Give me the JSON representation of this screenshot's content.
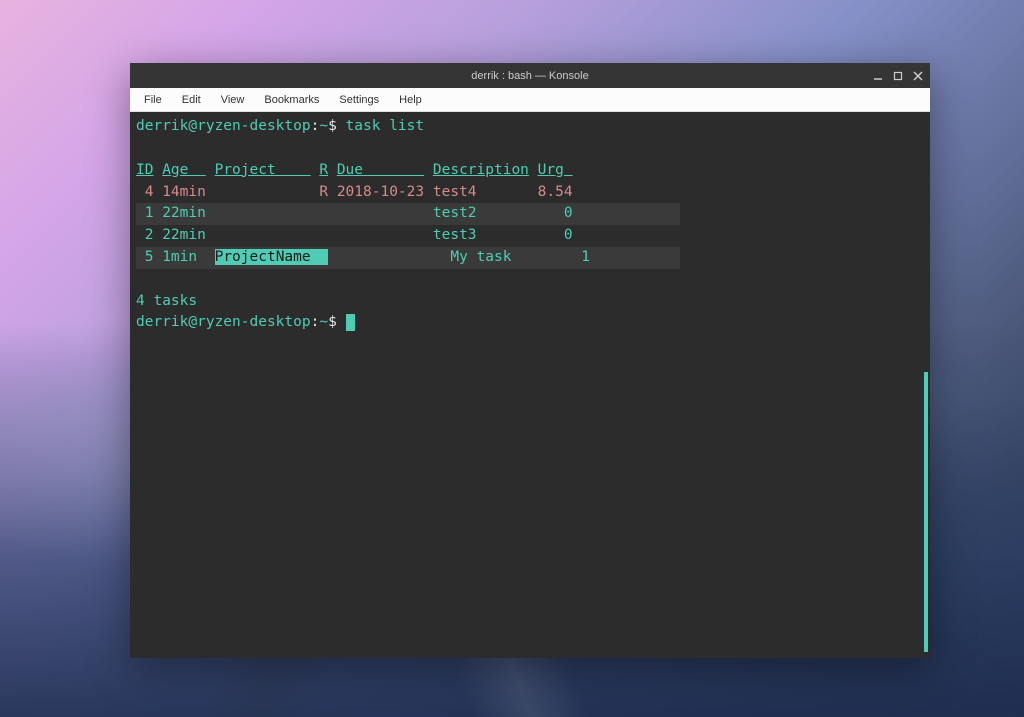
{
  "window": {
    "title": "derrik : bash — Konsole"
  },
  "menubar": {
    "items": [
      "File",
      "Edit",
      "View",
      "Bookmarks",
      "Settings",
      "Help"
    ]
  },
  "terminal": {
    "prompt_user": "derrik@ryzen-desktop",
    "prompt_sep": ":",
    "prompt_path": "~",
    "prompt_symbol": "$",
    "command": "task list",
    "headers": {
      "id": "ID",
      "age": "Age  ",
      "project": "Project    ",
      "r": "R",
      "due": "Due       ",
      "description": "Description",
      "urg": "Urg "
    },
    "rows": [
      {
        "type": "overdue",
        "id": " 4",
        "age": "14min",
        "project": "           ",
        "r": "R",
        "due": "2018-10-23",
        "description": "test4      ",
        "urg": "8.54"
      },
      {
        "type": "alt",
        "id": " 1",
        "age": "22min",
        "project": "           ",
        "r": " ",
        "due": "          ",
        "description": "test2      ",
        "urg": "   0"
      },
      {
        "type": "normal",
        "id": " 2",
        "age": "22min",
        "project": "           ",
        "r": " ",
        "due": "          ",
        "description": "test3      ",
        "urg": "   0"
      },
      {
        "type": "alt-project",
        "id": " 5",
        "age": "1min ",
        "project": "ProjectName  ",
        "r": " ",
        "due": "          ",
        "description": "My task    ",
        "urg": "   1"
      }
    ],
    "summary": "4 tasks"
  }
}
